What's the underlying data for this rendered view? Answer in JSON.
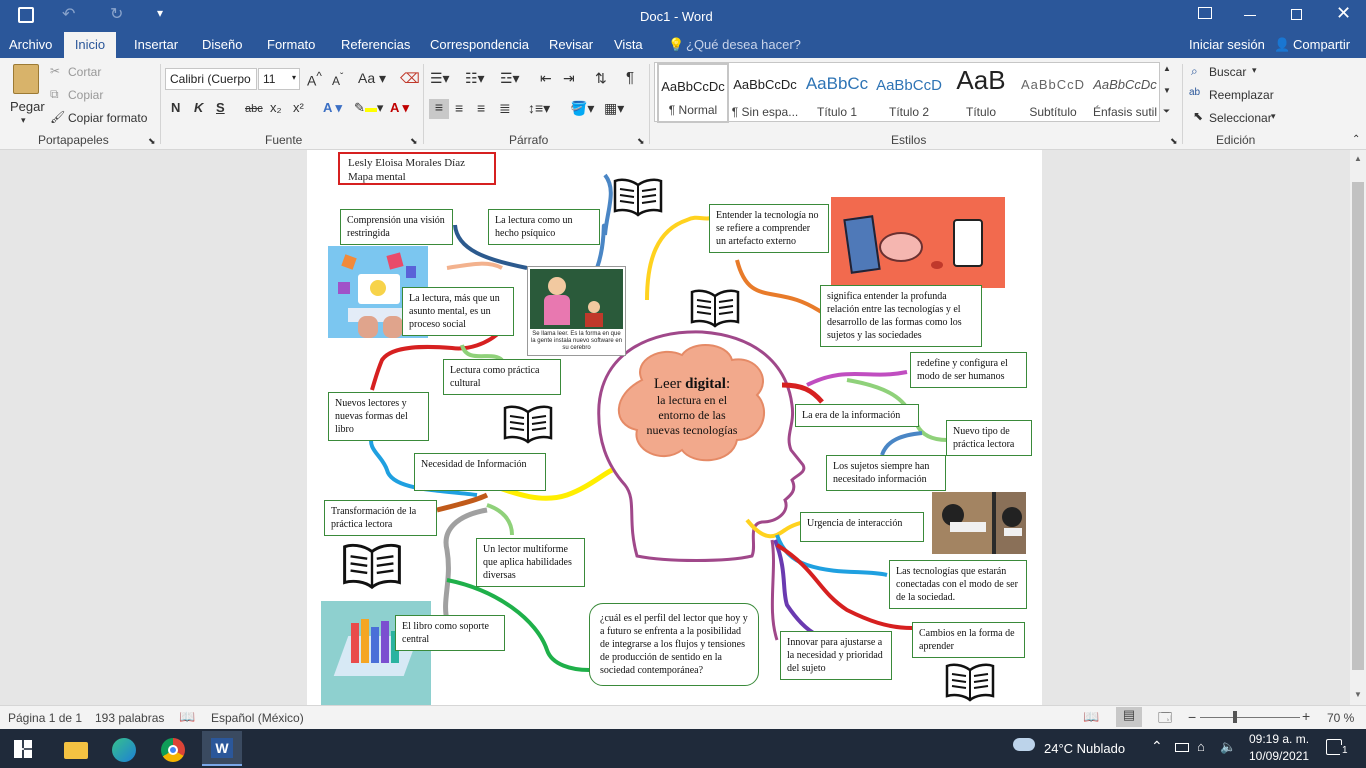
{
  "titlebar": {
    "title": "Doc1 - Word"
  },
  "menu": {
    "items": [
      "Archivo",
      "Inicio",
      "Insertar",
      "Diseño",
      "Formato",
      "Referencias",
      "Correspondencia",
      "Revisar",
      "Vista"
    ],
    "tellme": "¿Qué desea hacer?",
    "signin": "Iniciar sesión",
    "share": "Compartir"
  },
  "ribbon": {
    "clipboard": {
      "paste": "Pegar",
      "cut": "Cortar",
      "copy": "Copiar",
      "format_painter": "Copiar formato",
      "label": "Portapapeles"
    },
    "font": {
      "name": "Calibri (Cuerpo",
      "size": "11",
      "label": "Fuente",
      "bold": "N",
      "italic": "K",
      "underline": "S",
      "strike": "abc",
      "sub": "x₂",
      "sup": "x²"
    },
    "paragraph": {
      "label": "Párrafo"
    },
    "styles": {
      "label": "Estilos",
      "items": [
        {
          "preview": "AaBbCcDc",
          "name": "¶ Normal"
        },
        {
          "preview": "AaBbCcDc",
          "name": "¶ Sin espa..."
        },
        {
          "preview": "AaBbCc",
          "name": "Título 1"
        },
        {
          "preview": "AaBbCcD",
          "name": "Título 2"
        },
        {
          "preview": "AaB",
          "name": "Título"
        },
        {
          "preview": "AaBbCcD",
          "name": "Subtítulo"
        },
        {
          "preview": "AaBbCcDc",
          "name": "Énfasis sutil"
        }
      ]
    },
    "editing": {
      "find": "Buscar",
      "replace": "Reemplazar",
      "select": "Seleccionar",
      "label": "Edición"
    }
  },
  "document": {
    "header_name": "Lesly Eloisa Morales Díaz",
    "header_sub": "Mapa mental",
    "center": {
      "line1_a": "Leer ",
      "line1_b": "digital",
      "line1_c": ":",
      "rest": "la lectura en el entorno de las nuevas tecnologías"
    },
    "nodes": {
      "comprension": "Comprensión una visión restringida",
      "psiquico": "La lectura como un hecho psíquico",
      "entender": "Entender la tecnología no se refiere a comprender un artefacto externo",
      "significa": "significa entender la profunda relación entre las tecnologías y el desarrollo de las formas como los sujetos y las sociedades",
      "asunto": "La lectura, más que un asunto mental, es un proceso social",
      "practica_cultural": "Lectura como práctica cultural",
      "redefine": "redefine y configura el modo de ser humanos",
      "era": "La era de la información",
      "nuevo_tipo": "Nuevo tipo de práctica lectora",
      "nuevos_lectores": "Nuevos lectores y nuevas formas del libro",
      "sujetos": "Los sujetos siempre han necesitado información",
      "necesidad": "Necesidad de Información",
      "transformacion": "Transformación de la práctica lectora",
      "urgencia": "Urgencia de interacción",
      "multiforme": "Un lector multiforme que aplica habilidades diversas",
      "conectadas": "Las tecnologías que estarán conectadas con el modo de ser de la sociedad.",
      "soporte": "El libro como soporte central",
      "perfil": "¿cuál es el perfil del lector que hoy y a futuro se enfrenta a la posibilidad de integrarse a los flujos y tensiones de producción de sentido en la sociedad contemporánea?",
      "innovar": "Innovar para ajustarse a la necesidad y prioridad del sujeto",
      "cambios": "Cambios en la forma de aprender"
    },
    "cartoon_caption": "Se llama leer. Es la forma en que la gente instala nuevo software en su cerebro"
  },
  "status": {
    "page": "Página 1 de 1",
    "words": "193 palabras",
    "lang": "Español (México)",
    "zoom": "70 %"
  },
  "taskbar": {
    "weather": "24°C  Nublado",
    "time": "09:19 a. m.",
    "date": "10/09/2021",
    "notif": "1"
  },
  "colors": {
    "accent": "#2b579a",
    "green_border": "#3a8a3a",
    "red_border": "#d62020",
    "center_fill": "#f2a98c"
  }
}
